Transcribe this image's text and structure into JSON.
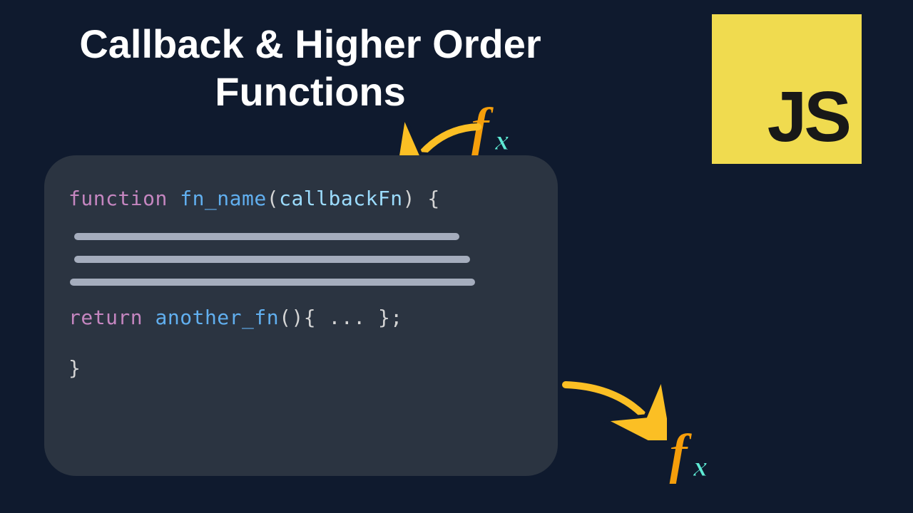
{
  "title": "Callback & Higher Order Functions",
  "logo": {
    "text": "JS"
  },
  "code": {
    "kw_function": "function",
    "fn_name": "fn_name",
    "param": "callbackFn",
    "open_sig": "(",
    "close_sig": ") {",
    "kw_return": "return",
    "another_fn": "another_fn",
    "return_tail": "(){ ... };",
    "close_brace": "}"
  },
  "fx": {
    "f": "f",
    "x": "x"
  }
}
